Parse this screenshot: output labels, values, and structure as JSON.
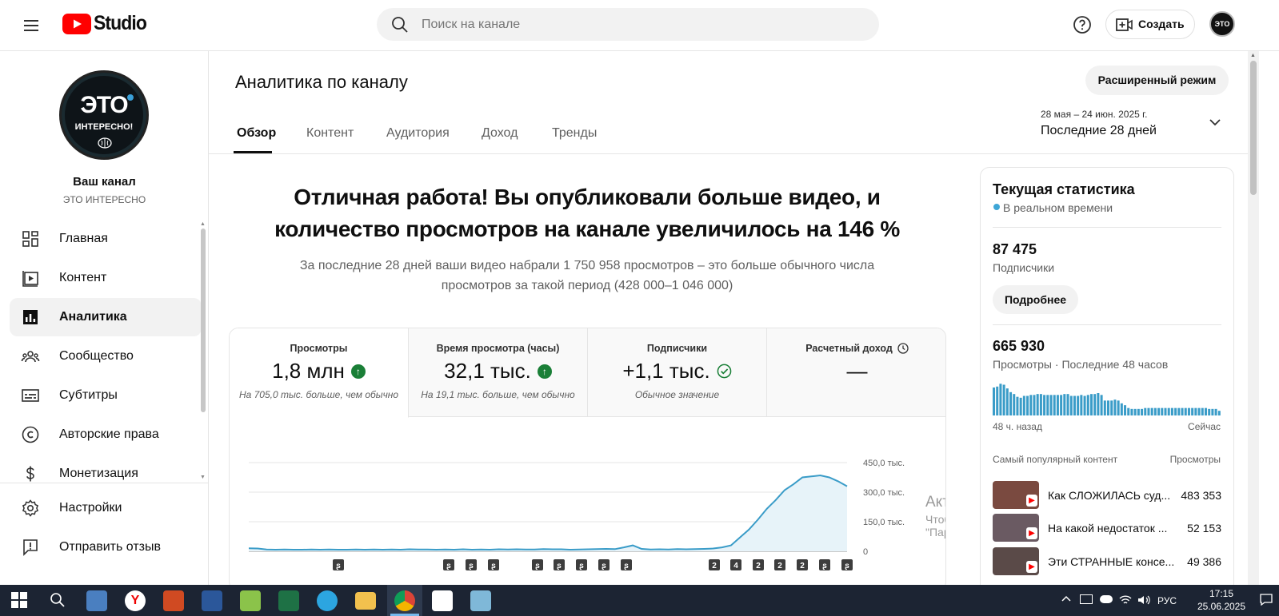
{
  "header": {
    "logo_text": "Studio",
    "search_placeholder": "Поиск на канале",
    "create_label": "Создать",
    "avatar_text": "ЭТО"
  },
  "channel": {
    "logo_big": "ЭТО",
    "logo_small": "ИНТЕРЕСНО!",
    "title": "Ваш канал",
    "name": "ЭТО ИНТЕРЕСНО"
  },
  "sidebar": {
    "items": [
      {
        "label": "Главная",
        "icon": "dashboard-icon"
      },
      {
        "label": "Контент",
        "icon": "content-icon"
      },
      {
        "label": "Аналитика",
        "icon": "analytics-icon"
      },
      {
        "label": "Сообщество",
        "icon": "community-icon"
      },
      {
        "label": "Субтитры",
        "icon": "subtitles-icon"
      },
      {
        "label": "Авторские права",
        "icon": "copyright-icon"
      },
      {
        "label": "Монетизация",
        "icon": "monetization-icon"
      }
    ],
    "bottom": [
      {
        "label": "Настройки",
        "icon": "gear-icon"
      },
      {
        "label": "Отправить отзыв",
        "icon": "feedback-icon"
      }
    ]
  },
  "page": {
    "title": "Аналитика по каналу",
    "advanced_mode": "Расширенный режим",
    "tabs": [
      "Обзор",
      "Контент",
      "Аудитория",
      "Доход",
      "Тренды"
    ],
    "date_range": "28 мая – 24 июн. 2025 г.",
    "date_label": "Последние 28 дней"
  },
  "summary": {
    "headline_1": "Отличная работа! Вы опубликовали больше видео, и",
    "headline_2": "количество просмотров на канале увеличилось на 146 %",
    "sub_1": "За последние 28 дней ваши видео набрали 1 750 958 просмотров – это больше обычного числа",
    "sub_2": "просмотров за такой период (428 000–1 046 000)"
  },
  "metrics": [
    {
      "title": "Просмотры",
      "value": "1,8 млн",
      "sub": "На 705,0 тыс. больше, чем обычно",
      "status": "up"
    },
    {
      "title": "Время просмотра (часы)",
      "value": "32,1 тыс.",
      "sub": "На 19,1 тыс. больше, чем обычно",
      "status": "up"
    },
    {
      "title": "Подписчики",
      "value": "+1,1 тыс.",
      "sub": "Обычное значение",
      "status": "normal"
    },
    {
      "title": "Расчетный доход",
      "value": "—",
      "sub": "",
      "status": "clock"
    }
  ],
  "chart_data": {
    "type": "area",
    "ylabels": [
      "450,0 тыс.",
      "300,0 тыс.",
      "150,0 тыс.",
      "0"
    ],
    "ylim": [
      0,
      450000
    ],
    "values": [
      15000,
      14000,
      9000,
      8000,
      9000,
      8000,
      8000,
      9000,
      8000,
      9000,
      8000,
      8000,
      9000,
      8000,
      9000,
      8000,
      9000,
      8000,
      10000,
      9000,
      9000,
      8000,
      9000,
      8000,
      10000,
      8000,
      9000,
      8000,
      10000,
      9000,
      10000,
      9000,
      9000,
      11000,
      10000,
      10000,
      8000,
      9000,
      10000,
      11000,
      12000,
      11000,
      20000,
      30000,
      12000,
      9000,
      10000,
      9000,
      11000,
      10000,
      11000,
      12000,
      14000,
      20000,
      30000,
      70000,
      110000,
      160000,
      215000,
      260000,
      310000,
      340000,
      375000,
      380000,
      385000,
      375000,
      355000,
      330000
    ],
    "markers": [
      "s",
      "s",
      "s",
      "s",
      "s",
      "s",
      "s",
      "s",
      "s",
      "2",
      "4",
      "2",
      "2",
      "2",
      "s",
      "s"
    ],
    "watermark_1": "Активация Windows",
    "watermark_2": "Чтобы активировать Windows, перейдите в раздел",
    "watermark_3": "\"Параметры\"."
  },
  "realtime": {
    "title": "Текущая статистика",
    "live": "В реальном времени",
    "subs_value": "87 475",
    "subs_label": "Подписчики",
    "details_button": "Подробнее",
    "views_value": "665 930",
    "views_label": "Просмотры · Последние 48 часов",
    "bars": [
      30,
      31,
      34,
      33,
      29,
      25,
      23,
      20,
      19,
      21,
      21,
      22,
      22,
      23,
      23,
      22,
      22,
      22,
      22,
      22,
      22,
      23,
      23,
      21,
      21,
      21,
      22,
      21,
      22,
      23,
      23,
      24,
      22,
      16,
      16,
      16,
      17,
      16,
      13,
      11,
      8,
      7,
      7,
      7,
      7,
      8,
      8,
      8,
      8,
      8,
      8,
      8,
      8,
      8,
      8,
      8,
      8,
      8,
      8,
      8,
      8,
      8,
      8,
      8,
      7,
      7,
      7,
      5
    ],
    "axis_left": "48 ч. назад",
    "axis_right": "Сейчас",
    "popular_label": "Самый популярный контент",
    "popular_metric": "Просмотры",
    "videos": [
      {
        "title": "Как СЛОЖИЛАСЬ суд...",
        "views": "483 353"
      },
      {
        "title": "На какой недостаток ...",
        "views": "52 153"
      },
      {
        "title": "Эти СТРАННЫЕ консе...",
        "views": "49 386"
      }
    ]
  },
  "taskbar": {
    "lang": "РУС",
    "time": "17:15",
    "date": "25.06.2025"
  }
}
